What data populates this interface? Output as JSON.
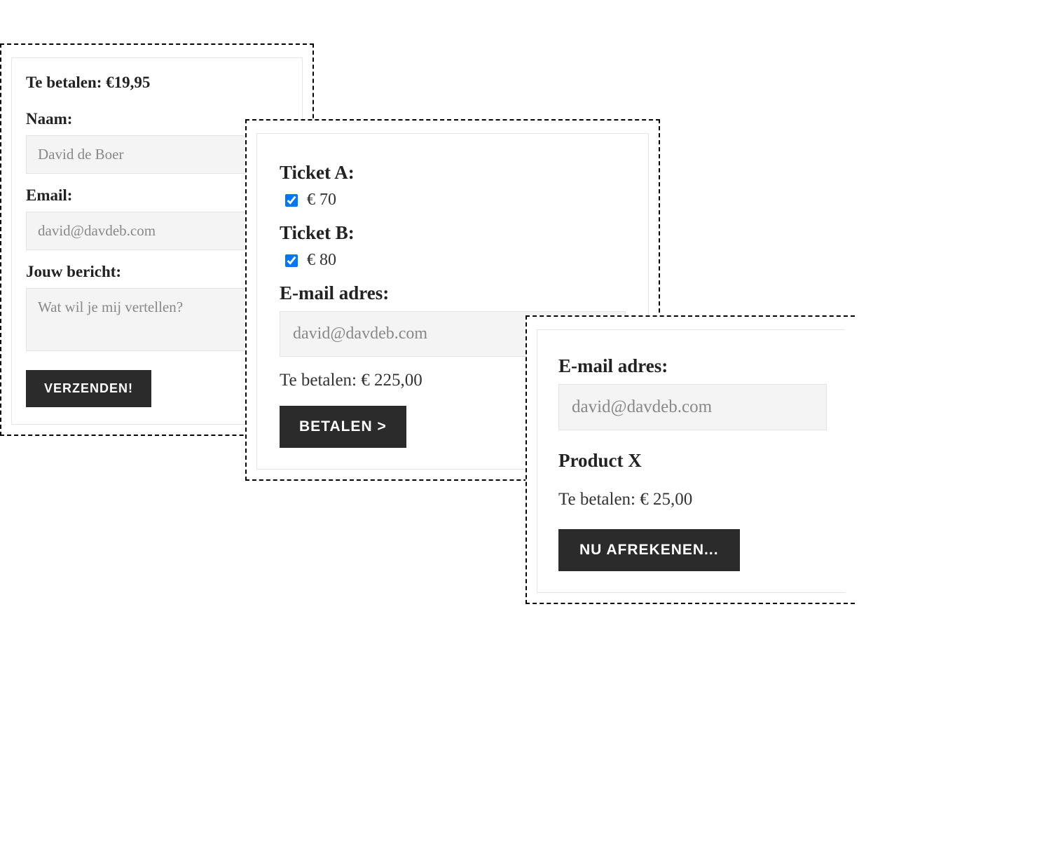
{
  "form1": {
    "total_line": "Te betalen: €19,95",
    "name_label": "Naam:",
    "name_placeholder": "David de Boer",
    "email_label": "Email:",
    "email_placeholder": "david@davdeb.com",
    "message_label": "Jouw bericht:",
    "message_placeholder": "Wat wil je mij vertellen?",
    "submit_label": "VERZENDEN!"
  },
  "form2": {
    "ticket_a_label": "Ticket A:",
    "ticket_a_price": "€ 70",
    "ticket_b_label": "Ticket B:",
    "ticket_b_price": "€ 80",
    "email_label": "E-mail adres:",
    "email_placeholder": "david@davdeb.com",
    "total_line": "Te betalen: € 225,00",
    "submit_label": "BETALEN >"
  },
  "form3": {
    "email_label": "E-mail adres:",
    "email_placeholder": "david@davdeb.com",
    "product_label": "Product X",
    "total_line": "Te betalen: € 25,00",
    "submit_label": "NU AFREKENEN..."
  }
}
